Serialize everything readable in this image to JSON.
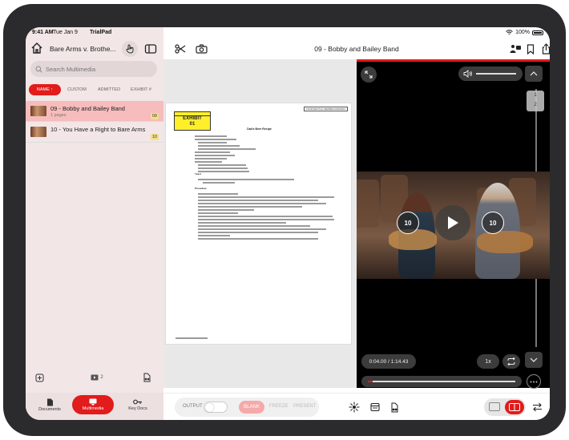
{
  "status_bar": {
    "time": "9:41 AM",
    "date": "Tue Jan 9",
    "app_name": "TrialPad",
    "battery": "100%"
  },
  "sidebar": {
    "case_title": "Bare Arms v. Brothe...",
    "search_placeholder": "Search Multimedia",
    "sort_options": [
      "NAME ↑",
      "CUSTOM",
      "ADMITTED",
      "EXHIBIT #"
    ],
    "items": [
      {
        "title": "09 - Bobby and Bailey Band",
        "subtitle": "1 pages",
        "badge": "09",
        "selected": true
      },
      {
        "title": "10 - You Have a Right to Bare Arms",
        "subtitle": "",
        "badge": "10",
        "selected": false
      }
    ],
    "media_count": "2",
    "tabs": [
      {
        "label": "Documents",
        "icon": "document-icon",
        "active": false
      },
      {
        "label": "Multimedia",
        "icon": "multimedia-icon",
        "active": true
      },
      {
        "label": "Key Docs",
        "icon": "key-docs-icon",
        "active": false
      }
    ]
  },
  "topbar": {
    "title": "09 - Bobby and Bailey Band"
  },
  "document": {
    "exhibit_label": "EXHIBIT",
    "exhibit_number": "01",
    "confidential": "CONFIDENTIAL BEMBE0-00000001",
    "recipe_title": "Dad's Beer Recipe",
    "procedure_label": "Procedure",
    "yeast_label": "Yeast"
  },
  "video": {
    "skip_back": "10",
    "skip_forward": "10",
    "page_numbers": [
      "1",
      "2"
    ],
    "time": "0:04.00 / 1:14.43",
    "speed": "1x",
    "progress_fraction": 0.03,
    "volume_fraction": 0.85
  },
  "bottombar": {
    "output_label": "OUTPUT",
    "blank_label": "BLANK",
    "freeze_label": "FREEZE",
    "present_label": "PRESENT"
  },
  "colors": {
    "accent": "#e21b1b",
    "sidebar_bg": "#f2e6e6",
    "selected_row": "#f7bcbc",
    "exhibit_yellow": "#ffef2a"
  }
}
